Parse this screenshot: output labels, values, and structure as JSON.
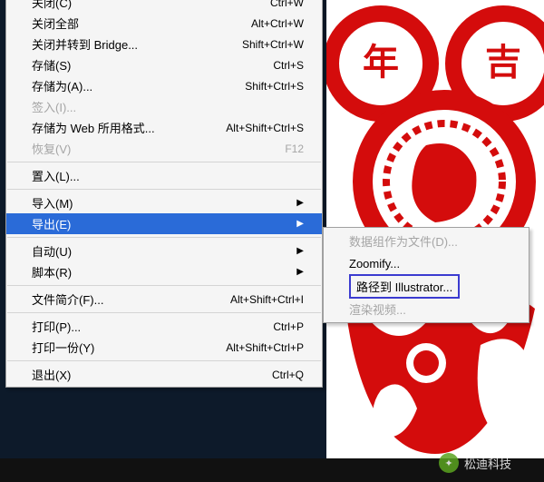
{
  "main_menu": [
    {
      "label": "关闭(C)",
      "shortcut": "Ctrl+W",
      "disabled": false
    },
    {
      "label": "关闭全部",
      "shortcut": "Alt+Ctrl+W",
      "disabled": false
    },
    {
      "label": "关闭并转到 Bridge...",
      "shortcut": "Shift+Ctrl+W",
      "disabled": false
    },
    {
      "label": "存储(S)",
      "shortcut": "Ctrl+S",
      "disabled": false
    },
    {
      "label": "存储为(A)...",
      "shortcut": "Shift+Ctrl+S",
      "disabled": false
    },
    {
      "label": "签入(I)...",
      "shortcut": "",
      "disabled": true
    },
    {
      "label": "存储为 Web 所用格式...",
      "shortcut": "Alt+Shift+Ctrl+S",
      "disabled": false
    },
    {
      "label": "恢复(V)",
      "shortcut": "F12",
      "disabled": true
    },
    {
      "sep": true
    },
    {
      "label": "置入(L)...",
      "shortcut": "",
      "disabled": false
    },
    {
      "sep": true
    },
    {
      "label": "导入(M)",
      "shortcut": "",
      "arrow": true
    },
    {
      "label": "导出(E)",
      "shortcut": "",
      "arrow": true,
      "highlighted": true
    },
    {
      "sep": true
    },
    {
      "label": "自动(U)",
      "shortcut": "",
      "arrow": true
    },
    {
      "label": "脚本(R)",
      "shortcut": "",
      "arrow": true
    },
    {
      "sep": true
    },
    {
      "label": "文件简介(F)...",
      "shortcut": "Alt+Shift+Ctrl+I",
      "disabled": false
    },
    {
      "sep": true
    },
    {
      "label": "打印(P)...",
      "shortcut": "Ctrl+P",
      "disabled": false
    },
    {
      "label": "打印一份(Y)",
      "shortcut": "Alt+Shift+Ctrl+P",
      "disabled": false
    },
    {
      "sep": true
    },
    {
      "label": "退出(X)",
      "shortcut": "Ctrl+Q",
      "disabled": false
    }
  ],
  "submenu": [
    {
      "label": "数据组作为文件(D)...",
      "disabled": true
    },
    {
      "label": "Zoomify..."
    },
    {
      "label": "路径到 Illustrator...",
      "boxed": true
    },
    {
      "label": "渲染视频...",
      "disabled": true
    }
  ],
  "watermark": {
    "text": "松迪科技",
    "icon": "wechat-icon"
  },
  "art_chars": {
    "top_left": "年",
    "top_right": "吉"
  }
}
